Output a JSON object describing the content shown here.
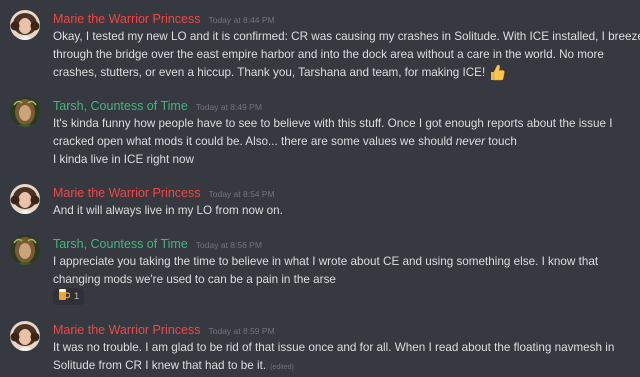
{
  "colors": {
    "marie": "#f04747",
    "tarsh": "#43b581",
    "timestamp": "#72767d",
    "background": "#36393f"
  },
  "messages": [
    {
      "author": "Marie the Warrior Princess",
      "timestamp": "Today at 8:44 PM",
      "avatar_icon": "avatar-marie",
      "lines": [
        "Okay, I tested my new LO and it is confirmed: CR was causing my crashes in Solitude. With ICE installed, I breeze",
        "through the bridge over the east empire harbor and into the dock area without a care in the world. No more",
        "crashes, stutters, or even a hiccup. Thank you, Tarshana and team, for making ICE!"
      ],
      "emoji": "thumbs-up-icon"
    },
    {
      "author": "Tarsh, Countess of Time",
      "timestamp": "Today at 8:49 PM",
      "avatar_icon": "avatar-tarsh",
      "lines": [
        "It's kinda funny how people have to see to believe with this stuff. Once I got enough reports about the issue I",
        "cracked open what mods it could be. Also... there are some values we should",
        "never",
        "touch",
        "I kinda live in ICE right now"
      ]
    },
    {
      "author": "Marie the Warrior Princess",
      "timestamp": "Today at 8:54 PM",
      "avatar_icon": "avatar-marie",
      "lines": [
        "And it will always live in my LO from now on."
      ]
    },
    {
      "author": "Tarsh, Countess of Time",
      "timestamp": "Today at 8:56 PM",
      "avatar_icon": "avatar-tarsh",
      "lines": [
        "I appreciate you taking the time to believe in what I wrote about CE and using something else. I know that",
        "changing mods we're used to can be a pain in the arse"
      ],
      "reaction": {
        "icon": "beer-mug-icon",
        "count": "1"
      }
    },
    {
      "author": "Marie the Warrior Princess",
      "timestamp": "Today at 8:59 PM",
      "avatar_icon": "avatar-marie",
      "lines": [
        "It was no trouble. I am glad to be rid of that issue once and for all. When I read about the floating navmesh in",
        "Solitude from CR I knew that had to be it."
      ],
      "edited": "(edited)"
    }
  ]
}
